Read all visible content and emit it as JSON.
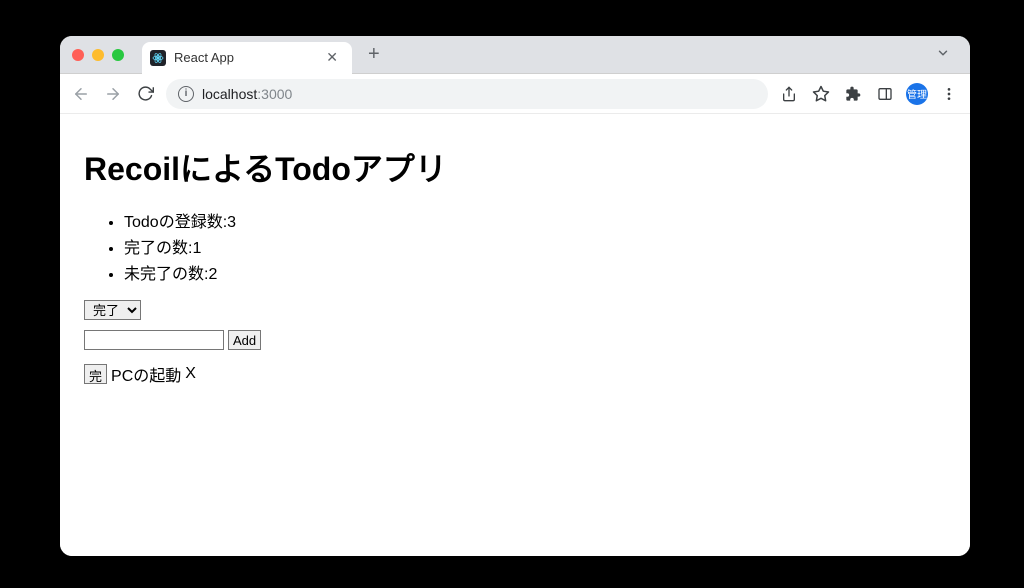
{
  "browser": {
    "tab_title": "React App",
    "url_host": "localhost",
    "url_port": ":3000",
    "profile_label": "管理"
  },
  "page": {
    "heading": "RecoilによるTodoアプリ",
    "stats": [
      {
        "label": "Todoの登録数:",
        "value": "3"
      },
      {
        "label": "完了の数:",
        "value": "1"
      },
      {
        "label": "未完了の数:",
        "value": "2"
      }
    ],
    "filter_selected": "完了",
    "new_todo_value": "",
    "add_button_label": "Add",
    "todos": [
      {
        "toggle_label": "完",
        "title": "PCの起動",
        "delete_label": "X"
      }
    ]
  }
}
